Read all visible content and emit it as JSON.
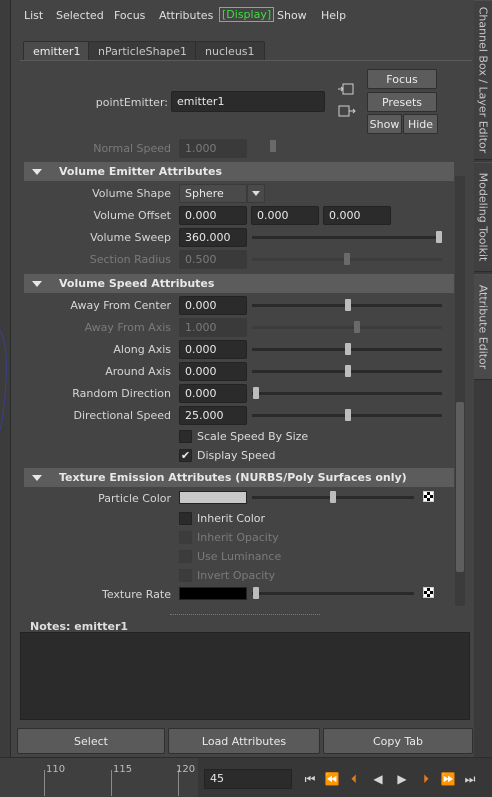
{
  "menu": [
    "List",
    "Selected",
    "Focus",
    "Attributes",
    "[Display]",
    "Show",
    "Help"
  ],
  "tabs": [
    "emitter1",
    "nParticleShape1",
    "nucleus1"
  ],
  "side_tabs": [
    "Channel Box / Layer Editor",
    "Modeling Toolkit",
    "Attribute Editor"
  ],
  "header": {
    "node_label": "pointEmitter:",
    "node_value": "emitter1",
    "focus": "Focus",
    "presets": "Presets",
    "show": "Show",
    "hide": "Hide"
  },
  "cut_row": {
    "label": "Normal Speed",
    "value": "1.000"
  },
  "volume_emitter": {
    "title": "Volume Emitter Attributes",
    "shape_label": "Volume Shape",
    "shape_value": "Sphere",
    "offset_label": "Volume Offset",
    "offset_values": [
      "0.000",
      "0.000",
      "0.000"
    ],
    "sweep_label": "Volume Sweep",
    "sweep_value": "360.000",
    "radius_label": "Section Radius",
    "radius_value": "0.500"
  },
  "volume_speed": {
    "title": "Volume Speed Attributes",
    "rows": [
      {
        "label": "Away From Center",
        "value": "0.000",
        "dim": false,
        "pos": 0.5
      },
      {
        "label": "Away From Axis",
        "value": "1.000",
        "dim": true,
        "pos": 0.55
      },
      {
        "label": "Along Axis",
        "value": "0.000",
        "dim": false,
        "pos": 0.5
      },
      {
        "label": "Around Axis",
        "value": "0.000",
        "dim": false,
        "pos": 0.5
      },
      {
        "label": "Random Direction",
        "value": "0.000",
        "dim": false,
        "pos": 0.0
      },
      {
        "label": "Directional Speed",
        "value": "25.000",
        "dim": false,
        "pos": 0.5
      }
    ],
    "scale_speed_label": "Scale Speed By Size",
    "scale_speed_checked": false,
    "display_speed_label": "Display Speed",
    "display_speed_checked": true
  },
  "texture_emission": {
    "title": "Texture Emission Attributes (NURBS/Poly Surfaces only)",
    "particle_color_label": "Particle Color",
    "particle_color": "#c8c8c8",
    "inherit_color": "Inherit Color",
    "inherit_opacity": "Inherit Opacity",
    "use_luminance": "Use Luminance",
    "invert_opacity": "Invert Opacity",
    "texture_rate_label": "Texture Rate",
    "texture_rate_color": "#000000"
  },
  "notes": {
    "label": "Notes:",
    "node": "emitter1"
  },
  "bottom_buttons": {
    "select": "Select",
    "load": "Load Attributes",
    "copy": "Copy Tab"
  },
  "timeline": {
    "ticks": [
      "110",
      "115",
      "120"
    ],
    "current_frame": "45"
  },
  "colors": {
    "display_menu": "#3be03b",
    "accent_playhead": "#e07a1a"
  }
}
